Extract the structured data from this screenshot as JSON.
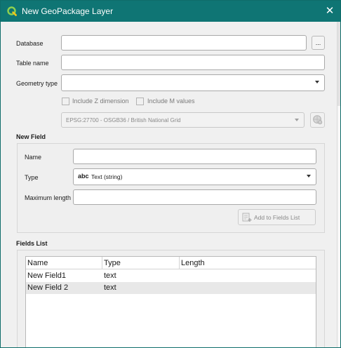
{
  "window": {
    "title": "New GeoPackage Layer",
    "logo_icon": "qgis-logo-icon",
    "close_icon": "close-icon",
    "titlebar_color": "#0f7574"
  },
  "form": {
    "database_label": "Database",
    "database_value": "",
    "browse_label": "...",
    "table_name_label": "Table name",
    "table_name_value": "",
    "geometry_type_label": "Geometry type",
    "geometry_type_value": "",
    "include_z_label": "Include Z dimension",
    "include_m_label": "Include M values",
    "crs_value": "EPSG:27700 - OSGB36 / British National Grid",
    "crs_button_icon": "crs-selector-icon"
  },
  "new_field": {
    "heading": "New Field",
    "name_label": "Name",
    "name_value": "",
    "type_label": "Type",
    "type_badge": "abc",
    "type_value": "Text (string)",
    "max_length_label": "Maximum length",
    "max_length_value": "",
    "add_button_label": "Add to Fields List",
    "add_button_icon": "add-field-icon"
  },
  "fields_list": {
    "heading": "Fields List",
    "columns": [
      "Name",
      "Type",
      "Length"
    ],
    "rows": [
      {
        "name": "New Field1",
        "type": "text",
        "length": ""
      },
      {
        "name": "New Field 2",
        "type": "text",
        "length": ""
      }
    ]
  }
}
